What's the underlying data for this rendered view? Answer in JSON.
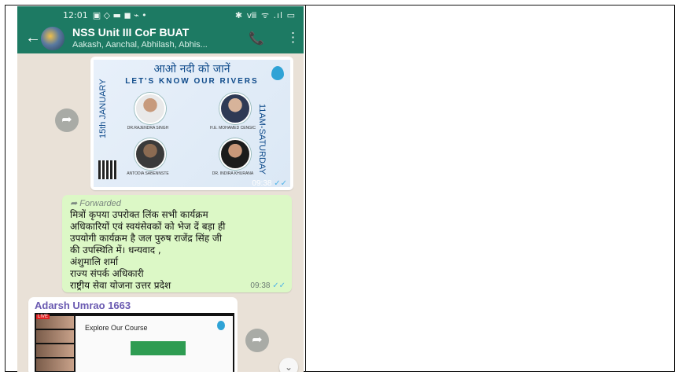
{
  "status_bar": {
    "time": "12:01",
    "icons_left": "▣ ◇ ▬ ◼ ⌁ •",
    "icons_right": "✱ ⅷ ᯤ .ıl ▭"
  },
  "header": {
    "title": "NSS Unit III CoF BUAT",
    "subtitle": "Aakash, Aanchal, Abhilash, Abhis...",
    "back_icon": "arrow-left",
    "call_icon": "add-call",
    "menu_icon": "more-vertical"
  },
  "poster": {
    "title_hindi": "आओ नदी को जानें",
    "title_english": "LET'S KNOW OUR RIVERS",
    "date_text": "15th JANUARY",
    "time_text": "11AM-SATURDAY",
    "speakers": [
      "DR.RAJENDRA SINGH",
      "H.E. MOHAMED CENGIC",
      "ANTODIA SABENNSTE",
      "DR. INDIRA KHURANA"
    ],
    "timestamp": "09:38",
    "check_icon": "✓✓"
  },
  "forwarded_message": {
    "forwarded_label": "Forwarded",
    "lines": [
      "मित्रों कृपया उपरोक्त लिंक सभी कार्यक्रम",
      "अधिकारियों एवं स्वयंसेवकों को भेज दें बड़ा ही",
      "उपयोगी कार्यक्रम है जल पुरुष राजेंद्र सिंह जी",
      "की उपस्थिति में। धन्यवाद ,",
      "अंशुमालि शर्मा",
      "राज्य संपर्क अधिकारी",
      " राष्ट्रीय सेवा योजना उत्तर प्रदेश"
    ],
    "timestamp": "09:38",
    "check_icon": "✓✓"
  },
  "media_message": {
    "sender": "Adarsh Umrao 1663",
    "slide_title": "Explore Our Course",
    "live_label": "LIVE"
  },
  "colors": {
    "header": "#1d7a63",
    "chat_bg": "#e9e1d7",
    "outgoing": "#dcf8c6",
    "sender": "#6a5ab1",
    "ticks": "#4fb3e8"
  }
}
